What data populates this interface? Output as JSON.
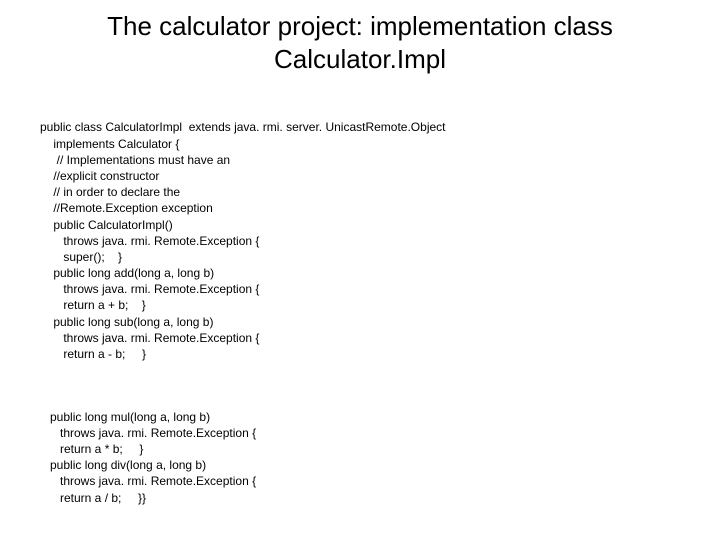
{
  "title": "The calculator project: implementation class Calculator.Impl",
  "code": {
    "block1": "public class CalculatorImpl  extends java. rmi. server. UnicastRemote.Object\n    implements Calculator {\n     // Implementations must have an\n    //explicit constructor\n    // in order to declare the\n    //Remote.Exception exception\n    public CalculatorImpl()\n       throws java. rmi. Remote.Exception {\n       super();    }\n    public long add(long a, long b)\n       throws java. rmi. Remote.Exception {\n       return a + b;    }\n    public long sub(long a, long b)\n       throws java. rmi. Remote.Exception {\n       return a - b;     }",
    "block2": "   public long mul(long a, long b)\n      throws java. rmi. Remote.Exception {\n      return a * b;     }\n   public long div(long a, long b)\n      throws java. rmi. Remote.Exception {\n      return a / b;     }}"
  }
}
